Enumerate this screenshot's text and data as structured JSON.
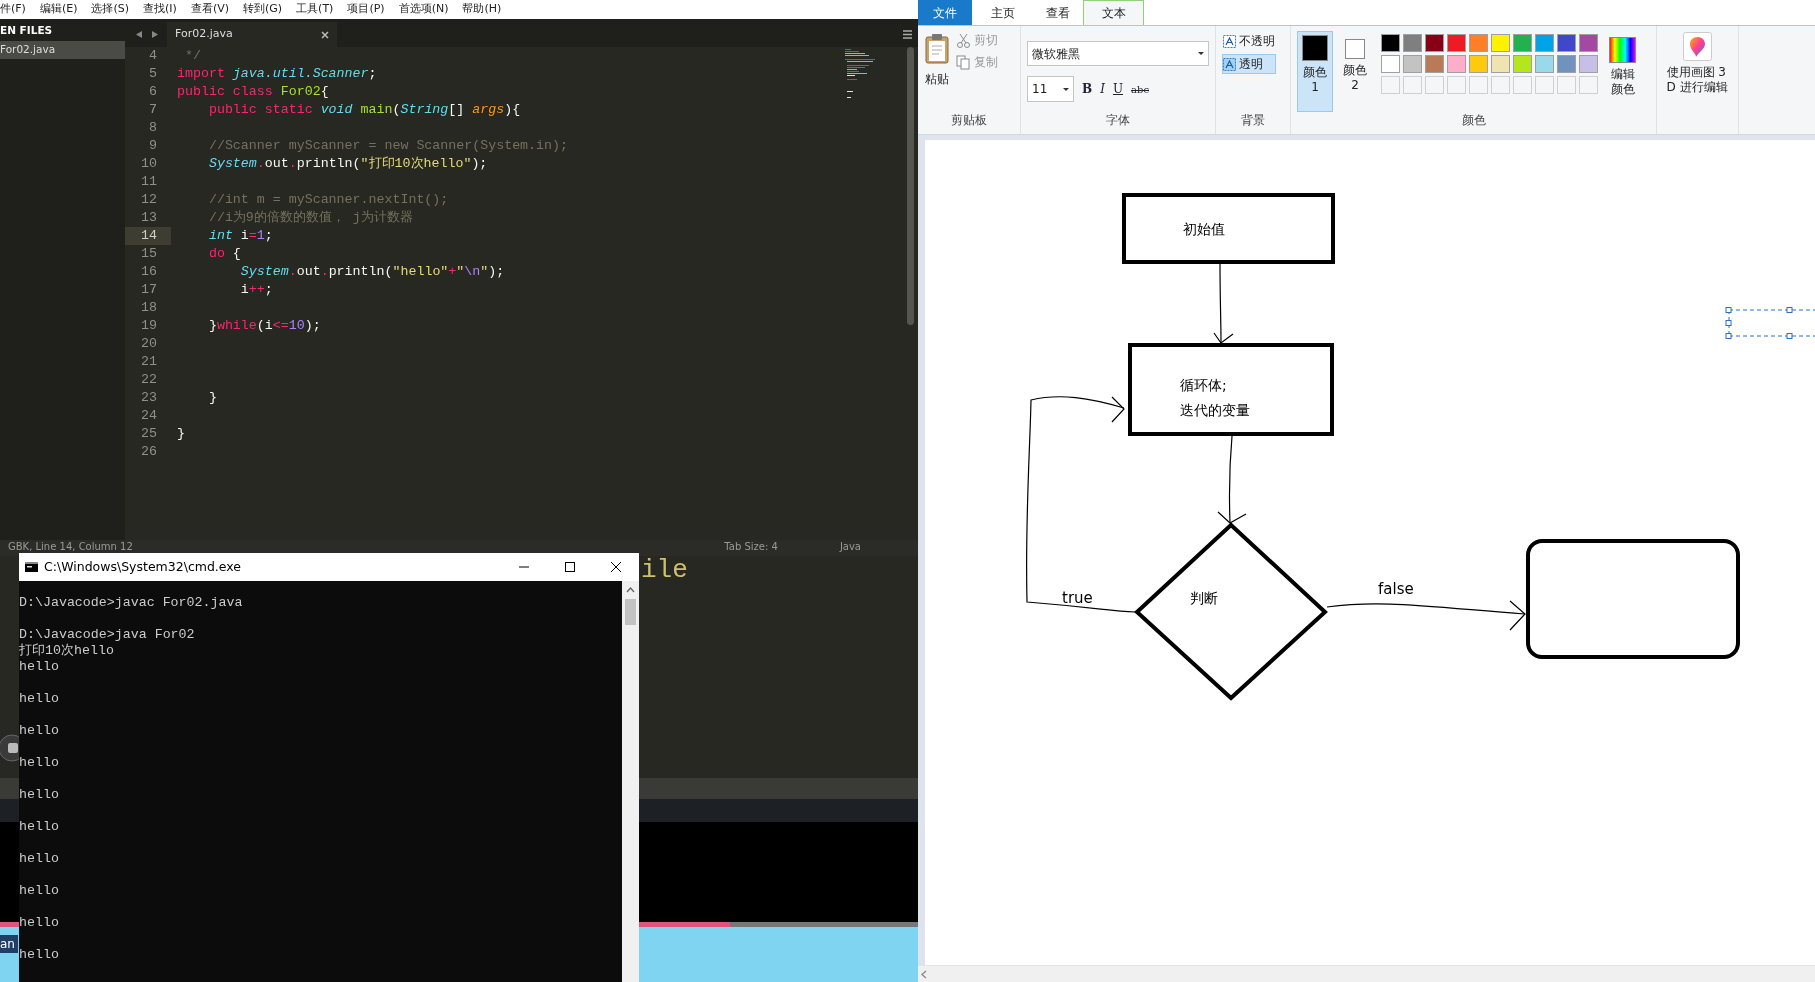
{
  "editor": {
    "menu": [
      "件(F)",
      "编辑(E)",
      "选择(S)",
      "查找(I)",
      "查看(V)",
      "转到(G)",
      "工具(T)",
      "项目(P)",
      "首选项(N)",
      "帮助(H)"
    ],
    "sidebar": {
      "header": "EN FILES",
      "files": [
        {
          "label": "For02.java",
          "selected": true
        }
      ]
    },
    "tabs": [
      {
        "label": "For02.java",
        "selected": true
      }
    ],
    "lines": [
      {
        "number": "4",
        "current": false,
        "tokens": [
          {
            "kind": "comment",
            "text": " */"
          }
        ]
      },
      {
        "number": "5",
        "current": false,
        "tokens": [
          {
            "kind": "keyword",
            "text": "import"
          },
          {
            "kind": "type",
            "text": " java.util.Scanner"
          },
          {
            "kind": "plain",
            "text": ";"
          }
        ]
      },
      {
        "number": "6",
        "current": false,
        "tokens": [
          {
            "kind": "keyword",
            "text": "public class"
          },
          {
            "kind": "name",
            "text": " For02"
          },
          {
            "kind": "plain",
            "text": "{"
          }
        ]
      },
      {
        "number": "7",
        "current": false,
        "tokens": [
          {
            "kind": "keyword",
            "text": "    public static"
          },
          {
            "kind": "type",
            "text": " void"
          },
          {
            "kind": "name",
            "text": " main"
          },
          {
            "kind": "plain",
            "text": "("
          },
          {
            "kind": "type",
            "text": "String"
          },
          {
            "kind": "plain",
            "text": "[] "
          },
          {
            "kind": "param",
            "text": "args"
          },
          {
            "kind": "plain",
            "text": "){"
          }
        ]
      },
      {
        "number": "8",
        "current": false
      },
      {
        "number": "9",
        "current": false,
        "tokens": [
          {
            "kind": "comment",
            "text": "    //Scanner myScanner = new Scanner(System.in);"
          }
        ]
      },
      {
        "number": "10",
        "current": false,
        "tokens": [
          {
            "kind": "type",
            "text": "    System"
          },
          {
            "kind": "keyword",
            "text": "."
          },
          {
            "kind": "plain",
            "text": "out"
          },
          {
            "kind": "keyword",
            "text": "."
          },
          {
            "kind": "plain",
            "text": "println("
          },
          {
            "kind": "string",
            "text": "\"打印10次hello\""
          },
          {
            "kind": "plain",
            "text": ");"
          }
        ]
      },
      {
        "number": "11",
        "current": false
      },
      {
        "number": "12",
        "current": false,
        "tokens": [
          {
            "kind": "comment",
            "text": "    //int m = myScanner.nextInt();"
          }
        ]
      },
      {
        "number": "13",
        "current": false,
        "tokens": [
          {
            "kind": "comment",
            "text": "    //i为9的倍数的数值， j为计数器"
          }
        ]
      },
      {
        "number": "14",
        "current": true,
        "tokens": [
          {
            "kind": "type",
            "text": "    int"
          },
          {
            "kind": "plain",
            "text": " i"
          },
          {
            "kind": "keyword",
            "text": "="
          },
          {
            "kind": "number",
            "text": "1"
          },
          {
            "kind": "plain",
            "text": ";"
          }
        ]
      },
      {
        "number": "15",
        "current": false,
        "tokens": [
          {
            "kind": "keyword",
            "text": "    do"
          },
          {
            "kind": "plain",
            "text": " {"
          }
        ]
      },
      {
        "number": "16",
        "current": false,
        "tokens": [
          {
            "kind": "type",
            "text": "        System"
          },
          {
            "kind": "keyword",
            "text": "."
          },
          {
            "kind": "plain",
            "text": "out"
          },
          {
            "kind": "keyword",
            "text": "."
          },
          {
            "kind": "plain",
            "text": "println("
          },
          {
            "kind": "string",
            "text": "\"hello\""
          },
          {
            "kind": "keyword",
            "text": "+"
          },
          {
            "kind": "string",
            "text": "\""
          },
          {
            "kind": "number",
            "text": "\\n"
          },
          {
            "kind": "string",
            "text": "\""
          },
          {
            "kind": "plain",
            "text": ");"
          }
        ]
      },
      {
        "number": "17",
        "current": false,
        "tokens": [
          {
            "kind": "plain",
            "text": "        i"
          },
          {
            "kind": "keyword",
            "text": "++"
          },
          {
            "kind": "plain",
            "text": ";"
          }
        ]
      },
      {
        "number": "18",
        "current": false
      },
      {
        "number": "19",
        "current": false,
        "tokens": [
          {
            "kind": "plain",
            "text": "    }"
          },
          {
            "kind": "keyword",
            "text": "while"
          },
          {
            "kind": "plain",
            "text": "(i"
          },
          {
            "kind": "keyword",
            "text": "<="
          },
          {
            "kind": "number",
            "text": "10"
          },
          {
            "kind": "plain",
            "text": ");"
          }
        ]
      },
      {
        "number": "20",
        "current": false
      },
      {
        "number": "21",
        "current": false
      },
      {
        "number": "22",
        "current": false
      },
      {
        "number": "23",
        "current": false,
        "tokens": [
          {
            "kind": "plain",
            "text": "    }"
          }
        ]
      },
      {
        "number": "24",
        "current": false
      },
      {
        "number": "25",
        "current": false,
        "tokens": [
          {
            "kind": "plain",
            "text": "}"
          }
        ]
      },
      {
        "number": "26",
        "current": false
      }
    ],
    "status_bar": {
      "position": "GBK, Line 14, Column 12",
      "tab_size": "Tab Size: 4",
      "syntax": "Java"
    }
  },
  "background_window": {
    "code_fragment": "ile",
    "taskbar_fragment": "an"
  },
  "console": {
    "title": "C:\\Windows\\System32\\cmd.exe",
    "lines": [
      {
        "kind": "text",
        "text": "D:\\Javacode>javac For02.java"
      },
      {
        "kind": "blank"
      },
      {
        "kind": "text",
        "text": "D:\\Javacode>java For02"
      },
      {
        "kind": "text",
        "text": "打印10次hello"
      },
      {
        "kind": "text",
        "text": "hello"
      },
      {
        "kind": "blank"
      },
      {
        "kind": "text",
        "text": "hello"
      },
      {
        "kind": "blank"
      },
      {
        "kind": "text",
        "text": "hello"
      },
      {
        "kind": "blank"
      },
      {
        "kind": "text",
        "text": "hello"
      },
      {
        "kind": "blank"
      },
      {
        "kind": "text",
        "text": "hello"
      },
      {
        "kind": "blank"
      },
      {
        "kind": "text",
        "text": "hello"
      },
      {
        "kind": "blank"
      },
      {
        "kind": "text",
        "text": "hello"
      },
      {
        "kind": "blank"
      },
      {
        "kind": "text",
        "text": "hello"
      },
      {
        "kind": "blank"
      },
      {
        "kind": "text",
        "text": "hello"
      },
      {
        "kind": "blank"
      },
      {
        "kind": "text",
        "text": "hello"
      }
    ]
  },
  "paint": {
    "tabs": [
      {
        "label": "文件",
        "kind": "file",
        "selected": false
      },
      {
        "label": "主页",
        "kind": "tab",
        "selected": false
      },
      {
        "label": "查看",
        "kind": "tab",
        "selected": false
      },
      {
        "label": "文本",
        "kind": "tab",
        "selected": true
      }
    ],
    "clipboard": {
      "paste": "粘贴",
      "cut": {
        "label": "剪切",
        "disabled": true
      },
      "copy": {
        "label": "复制",
        "disabled": true
      },
      "group": "剪贴板"
    },
    "font": {
      "family": "微软雅黑",
      "size": "11",
      "styles": [
        {
          "label": "B",
          "kind": "bold"
        },
        {
          "label": "I",
          "kind": "italic"
        },
        {
          "label": "U",
          "kind": "underline"
        },
        {
          "label": "abc",
          "kind": "strike"
        }
      ],
      "group": "字体"
    },
    "background": {
      "options": [
        {
          "label": "不透明",
          "selected": false
        },
        {
          "label": "透明",
          "selected": true
        }
      ],
      "group": "背景"
    },
    "colors": {
      "slots": [
        {
          "label": "颜色 1",
          "color": "#000000",
          "selected": true
        },
        {
          "label": "颜色 2",
          "color": "#ffffff",
          "selected": false
        }
      ],
      "palette": [
        {
          "kind": "swatch",
          "color": "#000000"
        },
        {
          "kind": "swatch",
          "color": "#7f7f7f"
        },
        {
          "kind": "swatch",
          "color": "#880015"
        },
        {
          "kind": "swatch",
          "color": "#ed1c24"
        },
        {
          "kind": "swatch",
          "color": "#ff7f27"
        },
        {
          "kind": "swatch",
          "color": "#fff200"
        },
        {
          "kind": "swatch",
          "color": "#22b14c"
        },
        {
          "kind": "swatch",
          "color": "#00a2e8"
        },
        {
          "kind": "swatch",
          "color": "#3f48cc"
        },
        {
          "kind": "swatch",
          "color": "#a349a4"
        },
        {
          "kind": "swatch",
          "color": "#ffffff"
        },
        {
          "kind": "swatch",
          "color": "#c3c3c3"
        },
        {
          "kind": "swatch",
          "color": "#b97a57"
        },
        {
          "kind": "swatch",
          "color": "#ffaec9"
        },
        {
          "kind": "swatch",
          "color": "#ffc90e"
        },
        {
          "kind": "swatch",
          "color": "#efe4b0"
        },
        {
          "kind": "swatch",
          "color": "#b5e61d"
        },
        {
          "kind": "swatch",
          "color": "#99d9ea"
        },
        {
          "kind": "swatch",
          "color": "#7092be"
        },
        {
          "kind": "swatch",
          "color": "#c8bfe7"
        },
        {
          "kind": "empty"
        },
        {
          "kind": "empty"
        },
        {
          "kind": "empty"
        },
        {
          "kind": "empty"
        },
        {
          "kind": "empty"
        },
        {
          "kind": "empty"
        },
        {
          "kind": "empty"
        },
        {
          "kind": "empty"
        },
        {
          "kind": "empty"
        },
        {
          "kind": "empty"
        }
      ],
      "edit": "编辑颜色",
      "group": "颜色"
    },
    "paint3d": "使用画图 3D 进行编辑",
    "flowchart": {
      "nodes": [
        {
          "kind": "process",
          "lines": [
            "初始值"
          ]
        },
        {
          "kind": "process",
          "lines": [
            "循环体;",
            "迭代的变量"
          ]
        },
        {
          "kind": "decision",
          "lines": [
            "判断"
          ]
        },
        {
          "kind": "terminal"
        }
      ],
      "edges": [
        {
          "kind": "down"
        },
        {
          "kind": "down"
        },
        {
          "kind": "loop",
          "label": "true"
        },
        {
          "kind": "branch",
          "label": "false"
        }
      ]
    }
  }
}
